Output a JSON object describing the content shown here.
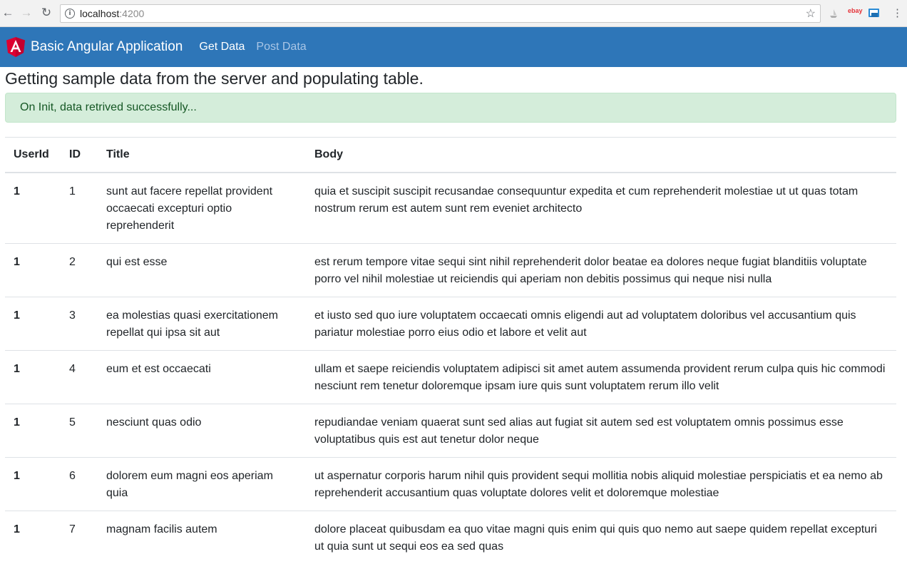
{
  "browser": {
    "back": "←",
    "forward": "→",
    "reload": "↻",
    "url_host": "localhost",
    "url_port": ":4200",
    "star": "☆",
    "ext_ebay": "ebay"
  },
  "navbar": {
    "brand": "Basic Angular Application",
    "links": [
      {
        "label": "Get Data"
      },
      {
        "label": "Post Data"
      }
    ]
  },
  "page": {
    "heading": "Getting sample data from the server and populating table.",
    "alert": "On Init, data retrived successfully..."
  },
  "table": {
    "headers": [
      "UserId",
      "ID",
      "Title",
      "Body"
    ],
    "rows": [
      {
        "userId": "1",
        "id": "1",
        "title": "sunt aut facere repellat provident occaecati excepturi optio reprehenderit",
        "body": "quia et suscipit suscipit recusandae consequuntur expedita et cum reprehenderit molestiae ut ut quas totam nostrum rerum est autem sunt rem eveniet architecto"
      },
      {
        "userId": "1",
        "id": "2",
        "title": "qui est esse",
        "body": "est rerum tempore vitae sequi sint nihil reprehenderit dolor beatae ea dolores neque fugiat blanditiis voluptate porro vel nihil molestiae ut reiciendis qui aperiam non debitis possimus qui neque nisi nulla"
      },
      {
        "userId": "1",
        "id": "3",
        "title": "ea molestias quasi exercitationem repellat qui ipsa sit aut",
        "body": "et iusto sed quo iure voluptatem occaecati omnis eligendi aut ad voluptatem doloribus vel accusantium quis pariatur molestiae porro eius odio et labore et velit aut"
      },
      {
        "userId": "1",
        "id": "4",
        "title": "eum et est occaecati",
        "body": "ullam et saepe reiciendis voluptatem adipisci sit amet autem assumenda provident rerum culpa quis hic commodi nesciunt rem tenetur doloremque ipsam iure quis sunt voluptatem rerum illo velit"
      },
      {
        "userId": "1",
        "id": "5",
        "title": "nesciunt quas odio",
        "body": "repudiandae veniam quaerat sunt sed alias aut fugiat sit autem sed est voluptatem omnis possimus esse voluptatibus quis est aut tenetur dolor neque"
      },
      {
        "userId": "1",
        "id": "6",
        "title": "dolorem eum magni eos aperiam quia",
        "body": "ut aspernatur corporis harum nihil quis provident sequi mollitia nobis aliquid molestiae perspiciatis et ea nemo ab reprehenderit accusantium quas voluptate dolores velit et doloremque molestiae"
      },
      {
        "userId": "1",
        "id": "7",
        "title": "magnam facilis autem",
        "body": "dolore placeat quibusdam ea quo vitae magni quis enim qui quis quo nemo aut saepe quidem repellat excepturi ut quia sunt ut sequi eos ea sed quas"
      }
    ]
  },
  "colors": {
    "navbar": "#2e76b8",
    "alert_bg": "#d4edda",
    "alert_text": "#155724",
    "angular_red": "#dd0031"
  }
}
